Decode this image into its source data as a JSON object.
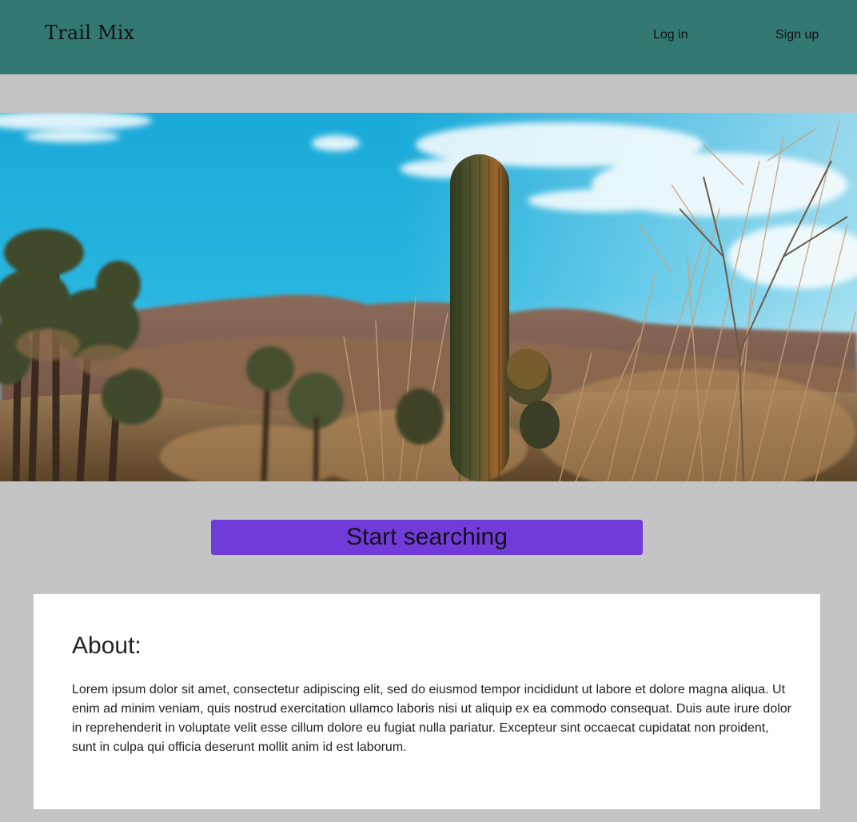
{
  "navbar": {
    "brand": "Trail Mix",
    "login_label": "Log in",
    "signup_label": "Sign up",
    "background_color": "#347872"
  },
  "hero": {
    "subject": "desert-landscape-with-saguaro-cactus-and-palm-trees"
  },
  "search": {
    "button_label": "Start searching",
    "button_color": "#713bd9"
  },
  "about": {
    "title": "About:",
    "body": "Lorem ipsum dolor sit amet, consectetur adipiscing elit, sed do eiusmod tempor incididunt ut labore et dolore magna aliqua. Ut enim ad minim veniam, quis nostrud exercitation ullamco laboris nisi ut aliquip ex ea commodo consequat. Duis aute irure dolor in reprehenderit in voluptate velit esse cillum dolore eu fugiat nulla pariatur. Excepteur sint occaecat cupidatat non proident, sunt in culpa qui officia deserunt mollit anim id est laborum."
  },
  "page": {
    "background_color": "#c4c4c4"
  }
}
